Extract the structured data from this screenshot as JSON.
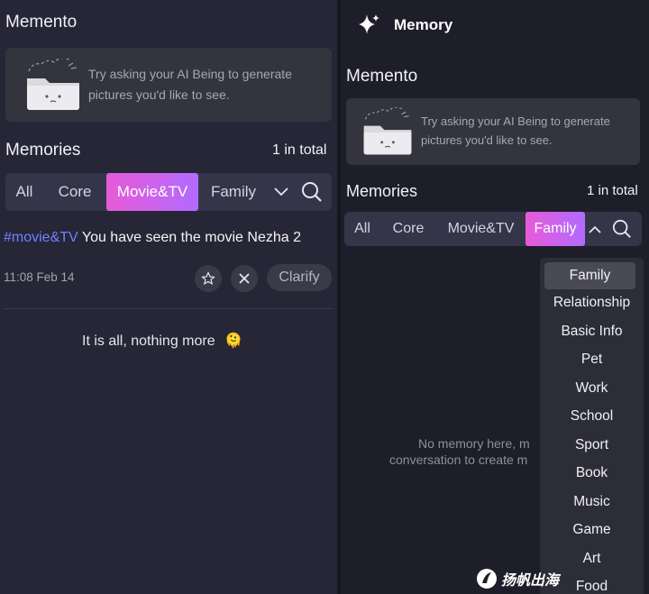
{
  "left": {
    "memento_title": "Memento",
    "hint": {
      "line1": "Try asking your AI Being to generate",
      "line2": "pictures you'd like to see."
    },
    "memories_title": "Memories",
    "count": "1 in total",
    "tabs": [
      {
        "label": "All",
        "active": false
      },
      {
        "label": "Core",
        "active": false
      },
      {
        "label": "Movie&TV",
        "active": true
      },
      {
        "label": "Family",
        "active": false
      }
    ],
    "memory": {
      "tag": "#movie&TV",
      "text": " You have seen the movie Nezha 2",
      "time": "11:08 Feb 14",
      "clarify_label": "Clarify"
    },
    "end_text": "It is all, nothing more",
    "end_emoji": "🫠"
  },
  "right": {
    "header_title": "Memory",
    "memento_title": "Memento",
    "hint": {
      "line1": "Try asking your AI Being to generate",
      "line2": "pictures you'd like to see."
    },
    "memories_title": "Memories",
    "count": "1 in total",
    "tabs": [
      {
        "label": "All",
        "active": false
      },
      {
        "label": "Core",
        "active": false
      },
      {
        "label": "Movie&TV",
        "active": false
      },
      {
        "label": "Family",
        "active": true
      }
    ],
    "empty": {
      "line1": "No memory here, m",
      "line2": "conversation to create m"
    },
    "dropdown": [
      "Family",
      "Relationship",
      "Basic Info",
      "Pet",
      "Work",
      "School",
      "Sport",
      "Book",
      "Music",
      "Game",
      "Art",
      "Food"
    ],
    "dropdown_selected": "Family"
  },
  "watermark": "扬帆出海",
  "colors": {
    "accent_start": "#e85ad8",
    "accent_end": "#b16bff",
    "tag_blue": "#6f83ff"
  }
}
